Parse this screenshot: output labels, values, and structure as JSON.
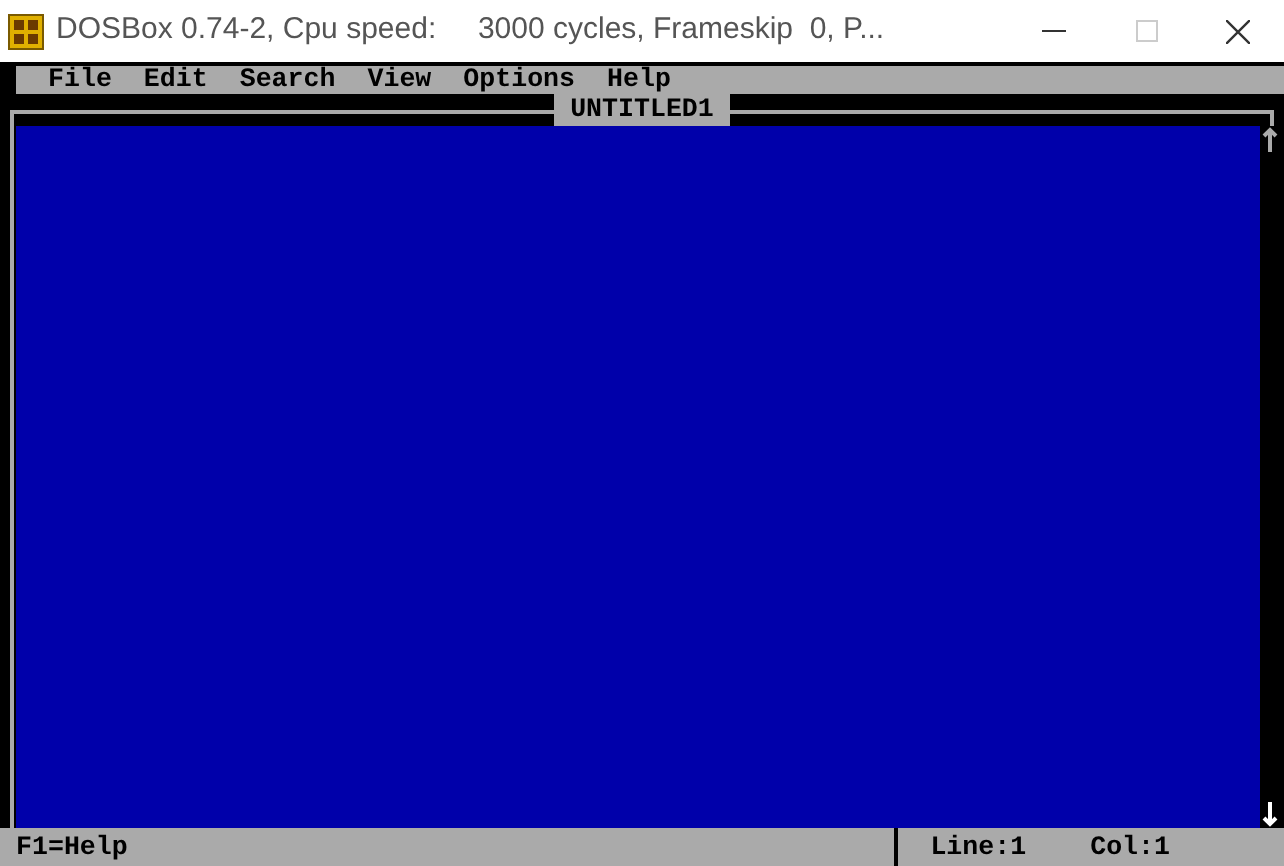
{
  "window": {
    "title": "DOSBox 0.74-2, Cpu speed:     3000 cycles, Frameskip  0, P...",
    "maximize_disabled": true
  },
  "menu": [
    "File",
    "Edit",
    "Search",
    "View",
    "Options",
    "Help"
  ],
  "document": {
    "title": "UNTITLED1"
  },
  "status_bar": {
    "help": "F1=Help",
    "line": "Line:1",
    "col": "Col:1"
  }
}
